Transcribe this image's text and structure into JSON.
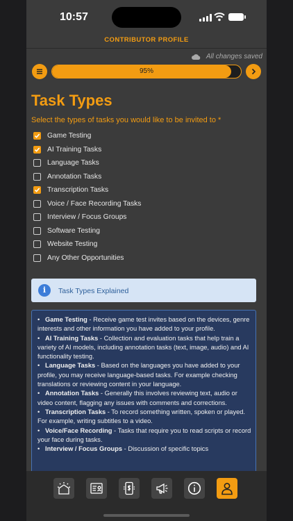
{
  "status_bar": {
    "time": "10:57"
  },
  "header": {
    "title": "CONTRIBUTOR PROFILE"
  },
  "save_status": "All changes saved",
  "progress": {
    "value": 0.95,
    "label": "95%"
  },
  "page": {
    "title": "Task Types",
    "prompt": "Select the types of tasks you would like to be invited to *"
  },
  "options": [
    {
      "label": "Game Testing",
      "checked": true
    },
    {
      "label": "AI Training Tasks",
      "checked": true
    },
    {
      "label": "Language Tasks",
      "checked": false
    },
    {
      "label": "Annotation Tasks",
      "checked": false
    },
    {
      "label": "Transcription Tasks",
      "checked": true
    },
    {
      "label": "Voice / Face Recording Tasks",
      "checked": false
    },
    {
      "label": "Interview / Focus Groups",
      "checked": false
    },
    {
      "label": "Software Testing",
      "checked": false
    },
    {
      "label": "Website Testing",
      "checked": false
    },
    {
      "label": "Any Other Opportunities",
      "checked": false
    }
  ],
  "info": {
    "title": "Task Types Explained"
  },
  "descriptions": [
    {
      "term": "Game Testing",
      "text": " - Receive game test invites based on the devices, genre interests and other information you have added to your profile."
    },
    {
      "term": "AI Training Tasks",
      "text": " - Collection and evaluation tasks that help train a variety of AI models, including annotation tasks (text, image, audio) and AI functionality testing."
    },
    {
      "term": "Language Tasks",
      "text": " - Based on the languages you have added to your profile, you may receive language-based tasks. For example checking translations or reviewing content in your language."
    },
    {
      "term": "Annotation Tasks",
      "text": " - Generally this involves reviewing text, audio or video content, flagging any issues with comments and corrections."
    },
    {
      "term": "Transcription Tasks",
      "text": " - To record something written, spoken or played. For example, writing subtitles to a video."
    },
    {
      "term": "Voice/Face Recording",
      "text": " - Tasks that require you to read scripts or record your face during tasks."
    },
    {
      "term": "Interview / Focus Groups",
      "text": " - Discussion of specific topics"
    }
  ],
  "tabs": [
    {
      "icon": "sun-home-icon",
      "active": false
    },
    {
      "icon": "profile-card-icon",
      "active": false
    },
    {
      "icon": "phone-payment-icon",
      "active": false
    },
    {
      "icon": "megaphone-icon",
      "active": false
    },
    {
      "icon": "info-icon",
      "active": false
    },
    {
      "icon": "person-icon",
      "active": true
    }
  ],
  "colors": {
    "accent": "#f39c12",
    "background": "#3b3b3b",
    "info_box": "#d6e4f5",
    "description_box": "#283a5f"
  }
}
